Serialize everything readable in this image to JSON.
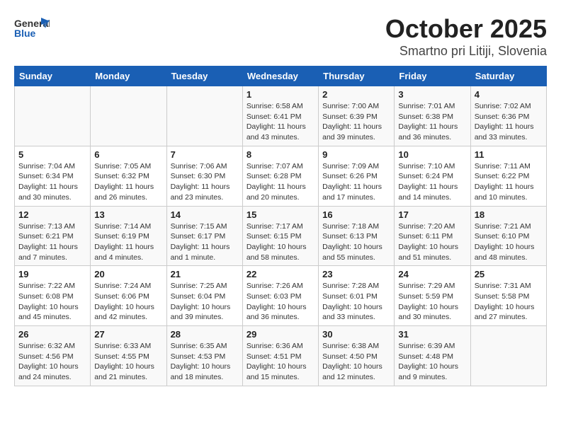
{
  "header": {
    "logo_line1": "General",
    "logo_line2": "Blue",
    "title": "October 2025",
    "subtitle": "Smartno pri Litiji, Slovenia"
  },
  "weekdays": [
    "Sunday",
    "Monday",
    "Tuesday",
    "Wednesday",
    "Thursday",
    "Friday",
    "Saturday"
  ],
  "weeks": [
    [
      {
        "day": "",
        "info": ""
      },
      {
        "day": "",
        "info": ""
      },
      {
        "day": "",
        "info": ""
      },
      {
        "day": "1",
        "info": "Sunrise: 6:58 AM\nSunset: 6:41 PM\nDaylight: 11 hours\nand 43 minutes."
      },
      {
        "day": "2",
        "info": "Sunrise: 7:00 AM\nSunset: 6:39 PM\nDaylight: 11 hours\nand 39 minutes."
      },
      {
        "day": "3",
        "info": "Sunrise: 7:01 AM\nSunset: 6:38 PM\nDaylight: 11 hours\nand 36 minutes."
      },
      {
        "day": "4",
        "info": "Sunrise: 7:02 AM\nSunset: 6:36 PM\nDaylight: 11 hours\nand 33 minutes."
      }
    ],
    [
      {
        "day": "5",
        "info": "Sunrise: 7:04 AM\nSunset: 6:34 PM\nDaylight: 11 hours\nand 30 minutes."
      },
      {
        "day": "6",
        "info": "Sunrise: 7:05 AM\nSunset: 6:32 PM\nDaylight: 11 hours\nand 26 minutes."
      },
      {
        "day": "7",
        "info": "Sunrise: 7:06 AM\nSunset: 6:30 PM\nDaylight: 11 hours\nand 23 minutes."
      },
      {
        "day": "8",
        "info": "Sunrise: 7:07 AM\nSunset: 6:28 PM\nDaylight: 11 hours\nand 20 minutes."
      },
      {
        "day": "9",
        "info": "Sunrise: 7:09 AM\nSunset: 6:26 PM\nDaylight: 11 hours\nand 17 minutes."
      },
      {
        "day": "10",
        "info": "Sunrise: 7:10 AM\nSunset: 6:24 PM\nDaylight: 11 hours\nand 14 minutes."
      },
      {
        "day": "11",
        "info": "Sunrise: 7:11 AM\nSunset: 6:22 PM\nDaylight: 11 hours\nand 10 minutes."
      }
    ],
    [
      {
        "day": "12",
        "info": "Sunrise: 7:13 AM\nSunset: 6:21 PM\nDaylight: 11 hours\nand 7 minutes."
      },
      {
        "day": "13",
        "info": "Sunrise: 7:14 AM\nSunset: 6:19 PM\nDaylight: 11 hours\nand 4 minutes."
      },
      {
        "day": "14",
        "info": "Sunrise: 7:15 AM\nSunset: 6:17 PM\nDaylight: 11 hours\nand 1 minute."
      },
      {
        "day": "15",
        "info": "Sunrise: 7:17 AM\nSunset: 6:15 PM\nDaylight: 10 hours\nand 58 minutes."
      },
      {
        "day": "16",
        "info": "Sunrise: 7:18 AM\nSunset: 6:13 PM\nDaylight: 10 hours\nand 55 minutes."
      },
      {
        "day": "17",
        "info": "Sunrise: 7:20 AM\nSunset: 6:11 PM\nDaylight: 10 hours\nand 51 minutes."
      },
      {
        "day": "18",
        "info": "Sunrise: 7:21 AM\nSunset: 6:10 PM\nDaylight: 10 hours\nand 48 minutes."
      }
    ],
    [
      {
        "day": "19",
        "info": "Sunrise: 7:22 AM\nSunset: 6:08 PM\nDaylight: 10 hours\nand 45 minutes."
      },
      {
        "day": "20",
        "info": "Sunrise: 7:24 AM\nSunset: 6:06 PM\nDaylight: 10 hours\nand 42 minutes."
      },
      {
        "day": "21",
        "info": "Sunrise: 7:25 AM\nSunset: 6:04 PM\nDaylight: 10 hours\nand 39 minutes."
      },
      {
        "day": "22",
        "info": "Sunrise: 7:26 AM\nSunset: 6:03 PM\nDaylight: 10 hours\nand 36 minutes."
      },
      {
        "day": "23",
        "info": "Sunrise: 7:28 AM\nSunset: 6:01 PM\nDaylight: 10 hours\nand 33 minutes."
      },
      {
        "day": "24",
        "info": "Sunrise: 7:29 AM\nSunset: 5:59 PM\nDaylight: 10 hours\nand 30 minutes."
      },
      {
        "day": "25",
        "info": "Sunrise: 7:31 AM\nSunset: 5:58 PM\nDaylight: 10 hours\nand 27 minutes."
      }
    ],
    [
      {
        "day": "26",
        "info": "Sunrise: 6:32 AM\nSunset: 4:56 PM\nDaylight: 10 hours\nand 24 minutes."
      },
      {
        "day": "27",
        "info": "Sunrise: 6:33 AM\nSunset: 4:55 PM\nDaylight: 10 hours\nand 21 minutes."
      },
      {
        "day": "28",
        "info": "Sunrise: 6:35 AM\nSunset: 4:53 PM\nDaylight: 10 hours\nand 18 minutes."
      },
      {
        "day": "29",
        "info": "Sunrise: 6:36 AM\nSunset: 4:51 PM\nDaylight: 10 hours\nand 15 minutes."
      },
      {
        "day": "30",
        "info": "Sunrise: 6:38 AM\nSunset: 4:50 PM\nDaylight: 10 hours\nand 12 minutes."
      },
      {
        "day": "31",
        "info": "Sunrise: 6:39 AM\nSunset: 4:48 PM\nDaylight: 10 hours\nand 9 minutes."
      },
      {
        "day": "",
        "info": ""
      }
    ]
  ]
}
